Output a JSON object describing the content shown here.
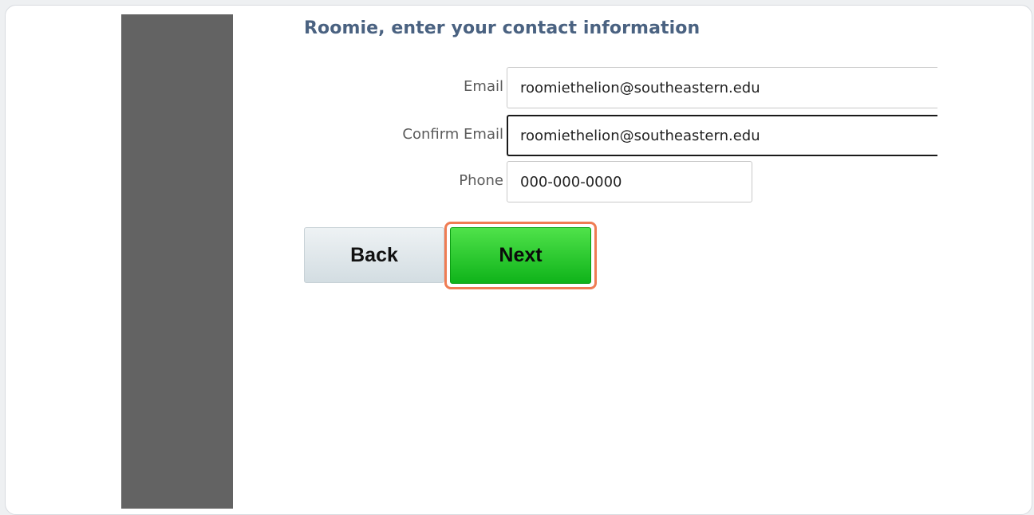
{
  "form": {
    "title": "Roomie, enter your contact information",
    "fields": [
      {
        "label": "Email",
        "value": "roomiethelion@southeastern.edu"
      },
      {
        "label": "Confirm Email",
        "value": "roomiethelion@southeastern.edu"
      },
      {
        "label": "Phone",
        "value": "000-000-0000"
      }
    ]
  },
  "buttons": {
    "back_label": "Back",
    "next_label": "Next"
  },
  "colors": {
    "sidebar": "#636363",
    "title": "#4a6281",
    "next_button": "#1bbf22",
    "highlight": "#ef7c53"
  }
}
